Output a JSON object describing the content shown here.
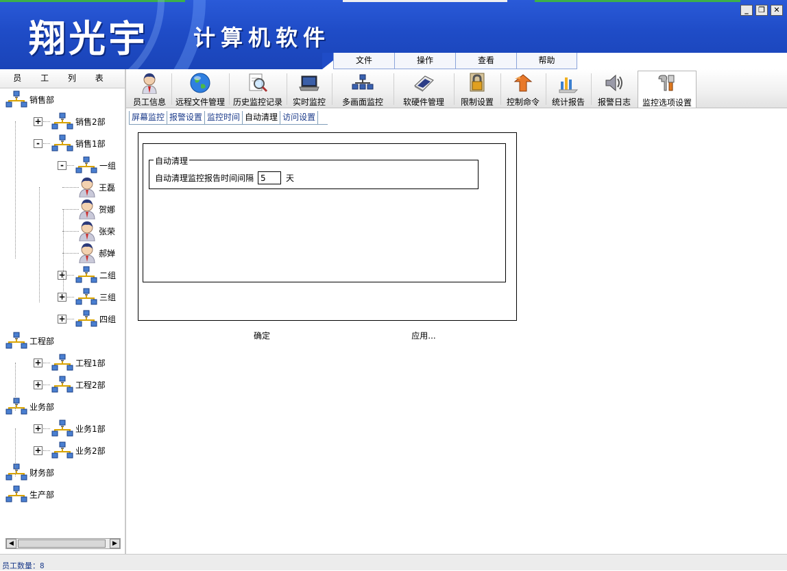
{
  "header": {
    "brand": "翔光宇",
    "product": "计算机软件",
    "window_controls": [
      "minimize-icon",
      "restore-icon",
      "close-icon"
    ],
    "colors": {
      "banner": "#1f4cc7"
    }
  },
  "menu": [
    "文件",
    "操作",
    "查看",
    "帮助"
  ],
  "left_panel": {
    "title": "员 工 列 表",
    "tree": [
      {
        "label": "销售部",
        "type": "dept"
      },
      {
        "label": "销售2部",
        "type": "dept",
        "expander": "+"
      },
      {
        "label": "销售1部",
        "type": "dept",
        "expander": "-"
      },
      {
        "label": "一组",
        "type": "dept",
        "expander": "-"
      },
      {
        "label": "王磊",
        "type": "user"
      },
      {
        "label": "贺娜",
        "type": "user"
      },
      {
        "label": "张荣",
        "type": "user"
      },
      {
        "label": "郝婵",
        "type": "user"
      },
      {
        "label": "二组",
        "type": "dept",
        "expander": "+"
      },
      {
        "label": "三组",
        "type": "dept",
        "expander": "+"
      },
      {
        "label": "四组",
        "type": "dept",
        "expander": "+"
      },
      {
        "label": "工程部",
        "type": "dept"
      },
      {
        "label": "工程1部",
        "type": "dept",
        "expander": "+"
      },
      {
        "label": "工程2部",
        "type": "dept",
        "expander": "+"
      },
      {
        "label": "业务部",
        "type": "dept"
      },
      {
        "label": "业务1部",
        "type": "dept",
        "expander": "+"
      },
      {
        "label": "业务2部",
        "type": "dept",
        "expander": "+"
      },
      {
        "label": "财务部",
        "type": "dept"
      },
      {
        "label": "生产部",
        "type": "dept"
      }
    ]
  },
  "toolbar": [
    {
      "label": "员工信息",
      "icon": "user-info-icon"
    },
    {
      "label": "远程文件管理",
      "icon": "globe-icon"
    },
    {
      "label": "历史监控记录",
      "icon": "magnifier-document-icon"
    },
    {
      "label": "实时监控",
      "icon": "laptop-icon"
    },
    {
      "label": "多画面监控",
      "icon": "network-icon"
    },
    {
      "label": "软硬件管理",
      "icon": "hardware-icon"
    },
    {
      "label": "限制设置",
      "icon": "lock-icon"
    },
    {
      "label": "控制命令",
      "icon": "command-icon"
    },
    {
      "label": "统计报告",
      "icon": "report-icon"
    },
    {
      "label": "报警日志",
      "icon": "speaker-icon"
    },
    {
      "label": "监控选项设置",
      "icon": "tools-icon",
      "active": true
    }
  ],
  "subtabs": [
    "屏幕监控",
    "报警设置",
    "监控时间",
    "自动清理",
    "访问设置"
  ],
  "selected_subtab": "自动清理",
  "auto_clean": {
    "group_title": "自动清理",
    "label": "自动清理监控报告时间间隔",
    "value": "5",
    "unit": "天"
  },
  "buttons": {
    "ok": "确定",
    "apply": "应用..."
  },
  "status": "员工数量：8"
}
